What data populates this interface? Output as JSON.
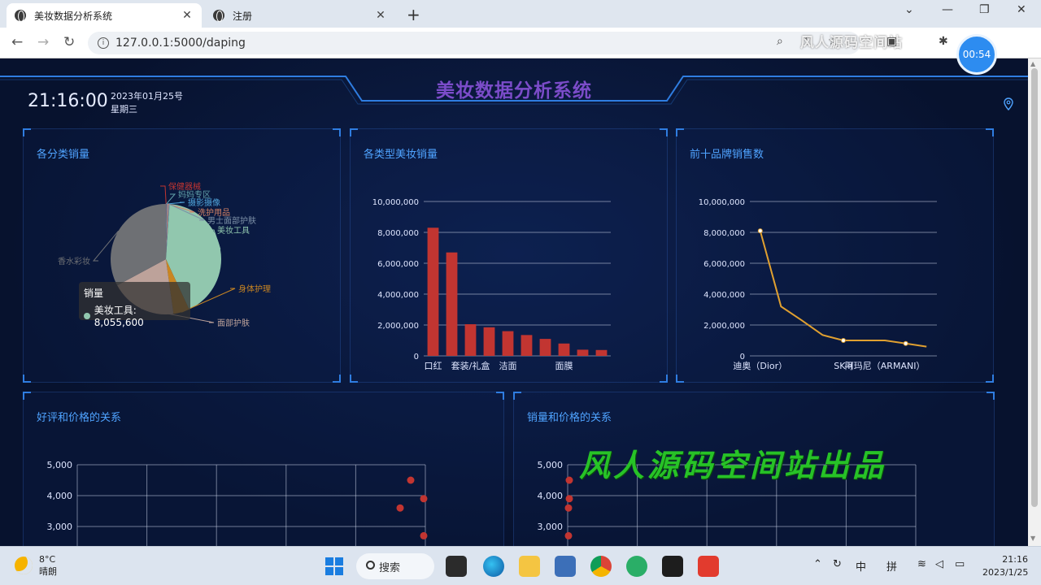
{
  "browser": {
    "tabs": [
      {
        "label": "美妆数据分析系统",
        "active": true
      },
      {
        "label": "注册",
        "active": false
      }
    ],
    "new_tab": "+",
    "url": "127.0.0.1:5000/daping",
    "window_controls": {
      "minimize": "—",
      "restore": "❐",
      "close": "✕"
    },
    "tab_close": "✕",
    "overlay_text": "风人源码空间站",
    "timer": "00:54"
  },
  "dashboard": {
    "title": "美妆数据分析系统",
    "time": "21:16:00",
    "date": "2023年01月25号",
    "weekday": "星期三",
    "watermark": "风人源码空间站出品",
    "panels": {
      "category_sales": "各分类销量",
      "type_sales": "各类型美妆销量",
      "top10_brands": "前十品牌销售数",
      "rating_price": "好评和价格的关系",
      "sales_price": "销量和价格的关系"
    },
    "tooltip": {
      "series": "销量",
      "item": "美妆工具: 8,055,600"
    }
  },
  "chart_data": [
    {
      "type": "pie",
      "title": "各分类销量",
      "labels": [
        "保健器械",
        "妈妈专区",
        "摄影摄像",
        "洗护用品",
        "男士面部护肤",
        "美妆工具",
        "身体护理",
        "面部护肤",
        "香水彩妆"
      ],
      "values": [
        20000,
        15000,
        40000,
        60000,
        70000,
        8055600,
        900000,
        3700000,
        6300000
      ],
      "colors": [
        "#c23531",
        "#61a0a8",
        "#4fa3d9",
        "#d48265",
        "#7b8fa6",
        "#91c7ae",
        "#ca8622",
        "#bda29a",
        "#6e7074"
      ]
    },
    {
      "type": "bar",
      "title": "各类型美妆销量",
      "categories": [
        "口红",
        "",
        "套装/礼盒",
        "",
        "洁面",
        "",
        "",
        "面膜",
        "",
        ""
      ],
      "values": [
        8300000,
        6700000,
        2050000,
        1850000,
        1600000,
        1350000,
        1100000,
        800000,
        400000,
        380000
      ],
      "ylim": [
        0,
        10000000
      ],
      "yticks": [
        "0",
        "2,000,000",
        "4,000,000",
        "6,000,000",
        "8,000,000",
        "10,000,000"
      ],
      "color": "#c23531"
    },
    {
      "type": "line",
      "title": "前十品牌销售数",
      "categories": [
        "迪奥（Dior）",
        "",
        "",
        "",
        "SK-II",
        "",
        "阿玛尼（ARMANI）",
        "",
        ""
      ],
      "values": [
        8100000,
        3200000,
        2300000,
        1350000,
        1000000,
        1000000,
        1000000,
        800000,
        600000
      ],
      "ylim": [
        0,
        10000000
      ],
      "yticks": [
        "0",
        "2,000,000",
        "4,000,000",
        "6,000,000",
        "8,000,000",
        "10,000,000"
      ],
      "color": "#e0a030"
    },
    {
      "type": "scatter",
      "title": "好评和价格的关系",
      "yticks_visible": [
        "3,000",
        "4,000",
        "5,000"
      ],
      "points": [
        [
          4.9,
          4500
        ],
        [
          5.0,
          3900
        ],
        [
          4.8,
          3600
        ],
        [
          5.0,
          2700
        ]
      ],
      "color": "#c23531"
    },
    {
      "type": "scatter",
      "title": "销量和价格的关系",
      "yticks_visible": [
        "3,000",
        "4,000",
        "5,000"
      ],
      "points": [
        [
          0,
          4500
        ],
        [
          0,
          3900
        ],
        [
          0,
          3600
        ],
        [
          0,
          2700
        ]
      ],
      "color": "#c23531"
    }
  ],
  "taskbar": {
    "weather_temp": "8°C",
    "weather_desc": "晴朗",
    "search": "搜索",
    "ime_1": "中",
    "ime_2": "拼",
    "clock_time": "21:16",
    "clock_date": "2023/1/25"
  }
}
